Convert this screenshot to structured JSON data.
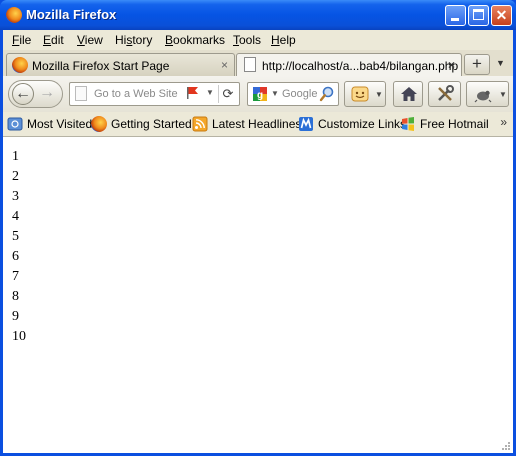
{
  "window": {
    "title": "Mozilla Firefox"
  },
  "menubar": {
    "items": [
      {
        "accel": "F",
        "rest": "ile"
      },
      {
        "accel": "E",
        "rest": "dit"
      },
      {
        "accel": "V",
        "rest": "iew"
      },
      {
        "accel": "",
        "pre": "Hi",
        "u": "s",
        "post": "tory"
      },
      {
        "accel": "B",
        "rest": "ookmarks"
      },
      {
        "accel": "T",
        "rest": "ools"
      },
      {
        "accel": "H",
        "rest": "elp"
      }
    ]
  },
  "tabs": [
    {
      "label": "Mozilla Firefox Start Page",
      "close": "×"
    },
    {
      "label": "http://localhost/a...bab4/bilangan.php",
      "close": "×"
    }
  ],
  "newtab": {
    "label": "+"
  },
  "tablist": {
    "label": "▼"
  },
  "navbar": {
    "back": "🡐",
    "forward": "🡒",
    "url_placeholder": "Go to a Web Site",
    "reload": "C",
    "search_placeholder": "Google"
  },
  "bookmarks": [
    {
      "label": "Most Visited"
    },
    {
      "label": "Getting Started"
    },
    {
      "label": "Latest Headlines"
    },
    {
      "label": "Customize Links"
    },
    {
      "label": "Free Hotmail"
    }
  ],
  "bookmarks_more": "»",
  "content": {
    "lines": [
      "1",
      "2",
      "3",
      "4",
      "5",
      "6",
      "7",
      "8",
      "9",
      "10"
    ]
  },
  "colors": {
    "titlebar": "#0654e4",
    "chrome": "#ece9d8"
  }
}
